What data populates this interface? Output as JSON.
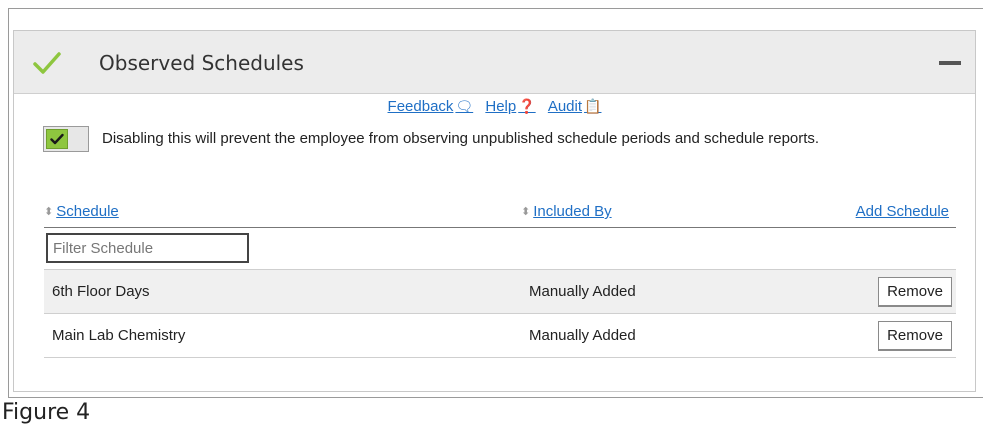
{
  "panel": {
    "title": "Observed Schedules",
    "icons": {
      "status": "check-icon",
      "collapse": "minus-icon"
    },
    "accent_color": "#8ec63f"
  },
  "links": {
    "feedback": "Feedback",
    "help": "Help",
    "audit": "Audit",
    "link_color": "#1f6fc5"
  },
  "toggle": {
    "state": "on",
    "description": "Disabling this will prevent the employee from observing unpublished schedule periods and schedule reports."
  },
  "table": {
    "columns": {
      "schedule": "Schedule",
      "included_by": "Included By"
    },
    "add_label": "Add Schedule",
    "filter_placeholder": "Filter Schedule",
    "rows": [
      {
        "schedule": "6th Floor Days",
        "included_by": "Manually Added",
        "action": "Remove"
      },
      {
        "schedule": "Main Lab Chemistry",
        "included_by": "Manually Added",
        "action": "Remove"
      }
    ]
  },
  "caption": "Figure 4"
}
